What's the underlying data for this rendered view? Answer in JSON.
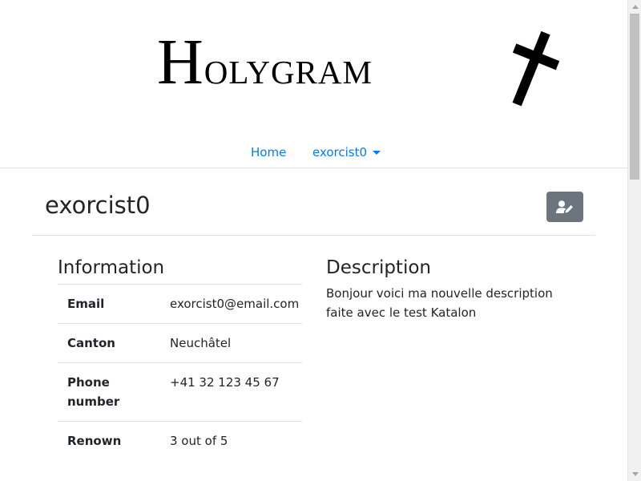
{
  "brand": {
    "first_letter": "H",
    "rest": "olygram",
    "logo_icon": "cross-icon"
  },
  "nav": {
    "home_label": "Home",
    "user_label": "exorcist0"
  },
  "profile": {
    "username": "exorcist0",
    "edit_icon": "user-edit-icon"
  },
  "information": {
    "heading": "Information",
    "rows": [
      {
        "label": "Email",
        "value": "exorcist0@email.com"
      },
      {
        "label": "Canton",
        "value": "Neuchâtel"
      },
      {
        "label": "Phone number",
        "value": "+41 32 123 45 67"
      },
      {
        "label": "Renown",
        "value": "3 out of 5"
      }
    ]
  },
  "description": {
    "heading": "Description",
    "text": "Bonjour voici ma nouvelle description faite avec le test Katalon"
  },
  "colors": {
    "link": "#007bff",
    "button": "#6c757d",
    "divider": "#dee2e6",
    "text": "#212529"
  }
}
